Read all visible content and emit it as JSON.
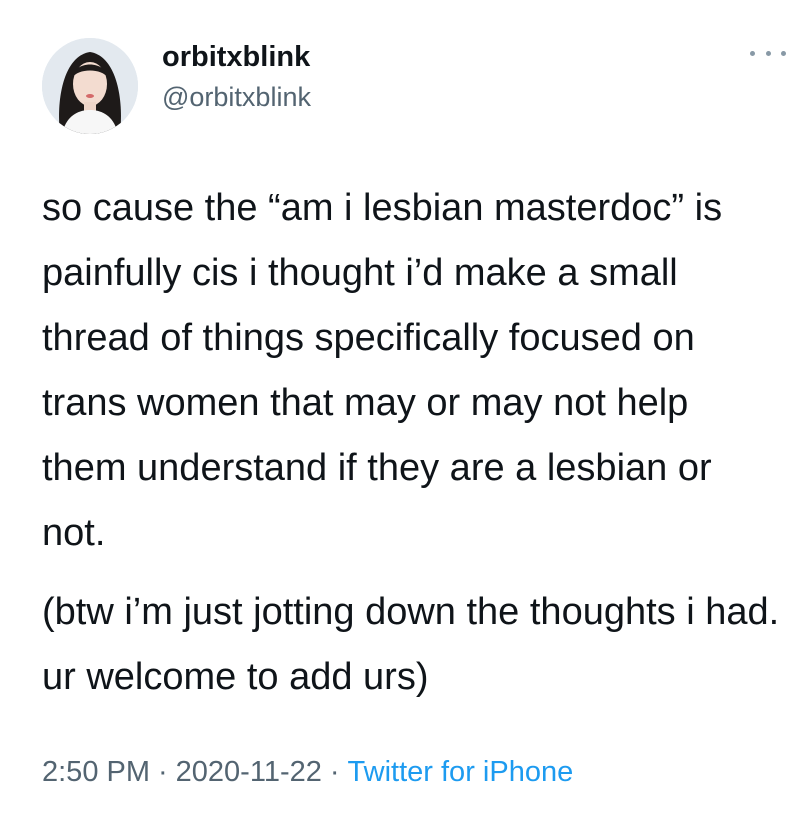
{
  "tweet": {
    "display_name": "orbitxblink",
    "handle": "@orbitxblink",
    "paragraphs": [
      "so cause the “am i lesbian masterdoc” is painfully cis i thought i’d make a small thread of things  specifically focused on trans women that may or may not help them understand if they are a lesbian or not.",
      "(btw i’m just jotting down the thoughts i had. ur welcome to add urs)"
    ],
    "time": "2:50 PM",
    "date": "2020-11-22",
    "separator": "·",
    "source": "Twitter for iPhone"
  },
  "icons": {
    "more": "more-icon",
    "avatar": "profile-photo"
  },
  "colors": {
    "text": "#0f1419",
    "secondary": "#536471",
    "link": "#1d9bf0",
    "background": "#ffffff"
  }
}
